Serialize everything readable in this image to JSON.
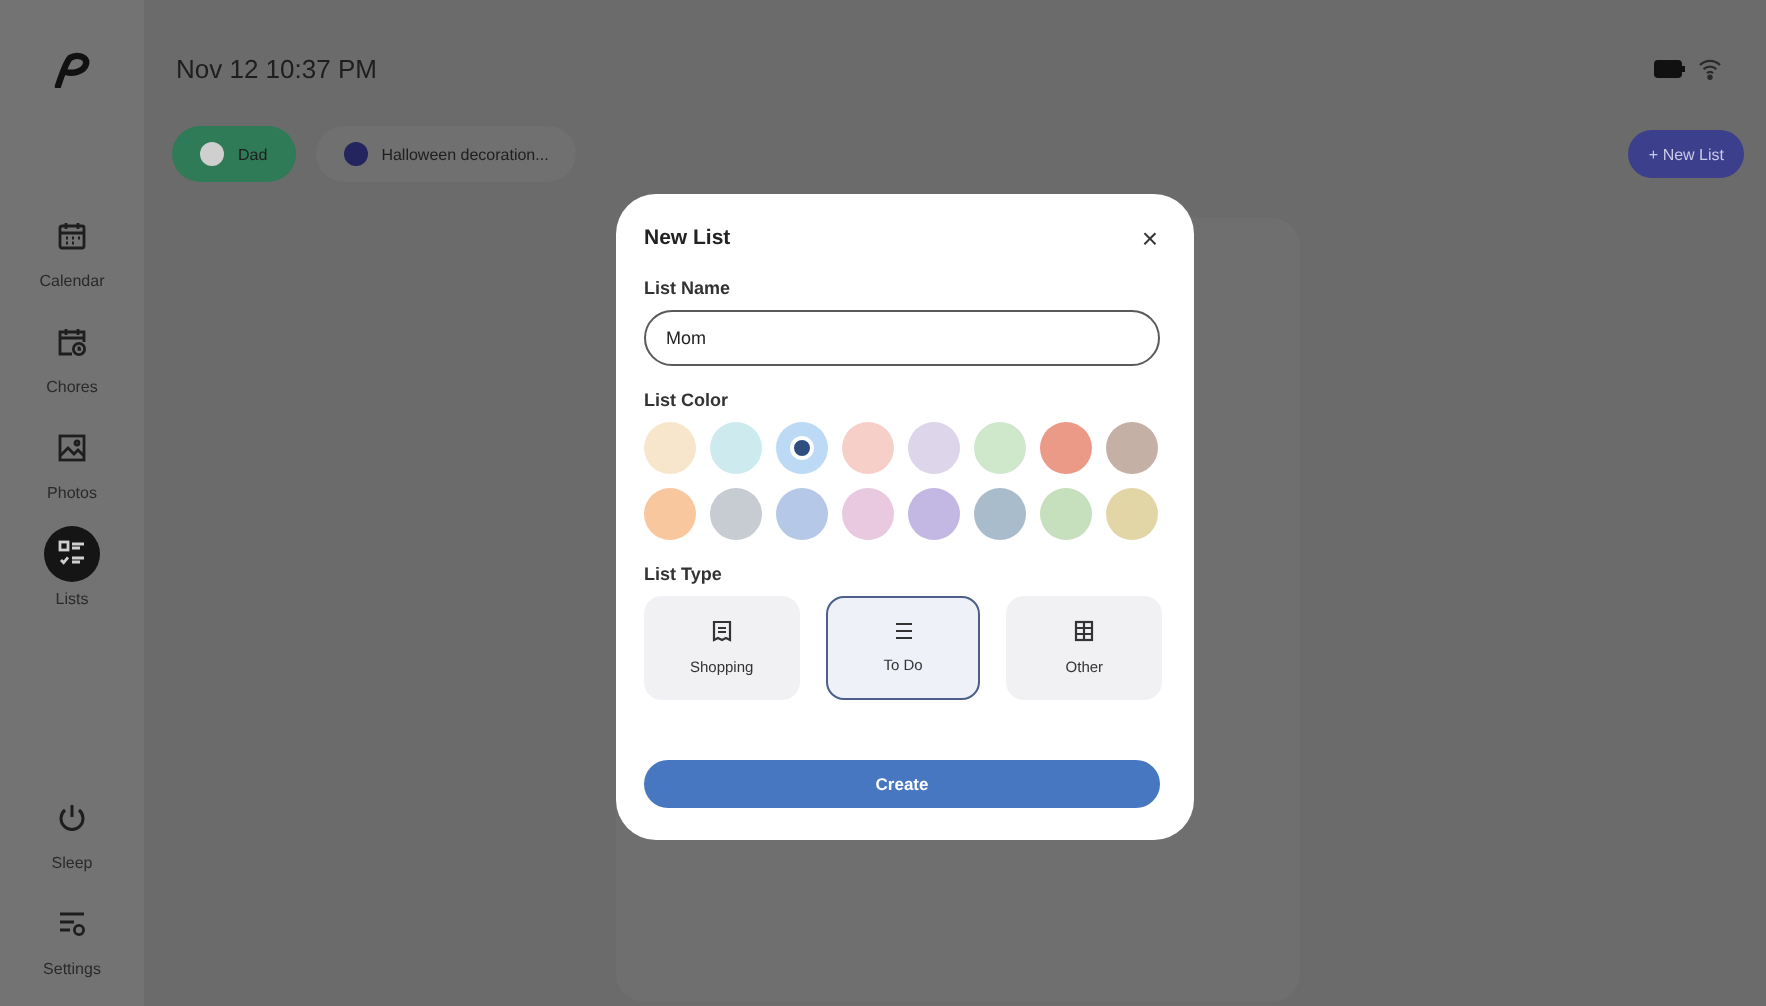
{
  "top_bar": {
    "datetime": "Nov 12 10:37 PM"
  },
  "sidebar": {
    "items": [
      {
        "label": "Calendar",
        "selected": false
      },
      {
        "label": "Chores",
        "selected": false
      },
      {
        "label": "Photos",
        "selected": false
      },
      {
        "label": "Lists",
        "selected": true
      },
      {
        "label": "Sleep",
        "selected": false
      },
      {
        "label": "Settings",
        "selected": false
      }
    ]
  },
  "chips": [
    {
      "label": "Dad",
      "selected": true,
      "color": "#cfcfcf"
    },
    {
      "label": "Halloween decoration...",
      "selected": false,
      "color": "#24245e"
    }
  ],
  "new_list_button": "+ New List",
  "dialog": {
    "title": "New List",
    "close": "×",
    "name_label": "List Name",
    "name_value": "Mom",
    "color_label": "List Color",
    "colors": [
      {
        "color": "#f8e6cc",
        "selected": false
      },
      {
        "color": "#cdebee",
        "selected": false
      },
      {
        "color": "#bcd9f5",
        "selected": true
      },
      {
        "color": "#f7cfc9",
        "selected": false
      },
      {
        "color": "#ddd5ea",
        "selected": false
      },
      {
        "color": "#cfe8cc",
        "selected": false
      },
      {
        "color": "#ec9a88",
        "selected": false
      },
      {
        "color": "#c4b0a4",
        "selected": false
      },
      {
        "color": "#f9c79e",
        "selected": false
      },
      {
        "color": "#c7ccd3",
        "selected": false
      },
      {
        "color": "#b5c8e8",
        "selected": false
      },
      {
        "color": "#e8c9e0",
        "selected": false
      },
      {
        "color": "#c2b8e3",
        "selected": false
      },
      {
        "color": "#a9bccc",
        "selected": false
      },
      {
        "color": "#c6dfbd",
        "selected": false
      },
      {
        "color": "#e2d6a6",
        "selected": false
      }
    ],
    "type_label": "List Type",
    "types": [
      {
        "label": "Shopping",
        "selected": false
      },
      {
        "label": "To Do",
        "selected": true
      },
      {
        "label": "Other",
        "selected": false
      }
    ],
    "create_button": "Create"
  }
}
